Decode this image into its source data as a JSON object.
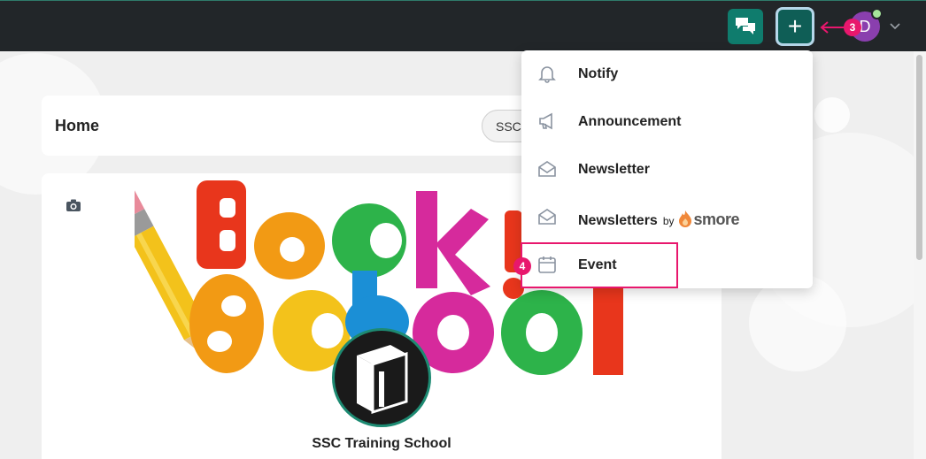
{
  "header": {
    "chat_icon": "chat-bubbles-icon",
    "add_label": "+",
    "avatar_initial": "D",
    "step_callout": "3",
    "accent_color": "#0f7c6d",
    "highlight_color": "#e8176d"
  },
  "home": {
    "title": "Home",
    "school_pill": "SSC"
  },
  "profile": {
    "camera_icon": "camera-icon",
    "school_name": "SSC Training School",
    "school_sub": "—"
  },
  "menu": {
    "items": [
      {
        "label": "Notify",
        "icon": "bell-icon"
      },
      {
        "label": "Announcement",
        "icon": "megaphone-icon"
      },
      {
        "label": "Newsletter",
        "icon": "envelope-icon"
      },
      {
        "label": "Newsletters",
        "icon": "envelope-icon",
        "by": "by",
        "brand": "smore"
      },
      {
        "label": "Event",
        "icon": "calendar-icon"
      }
    ],
    "step_callout": "4"
  }
}
